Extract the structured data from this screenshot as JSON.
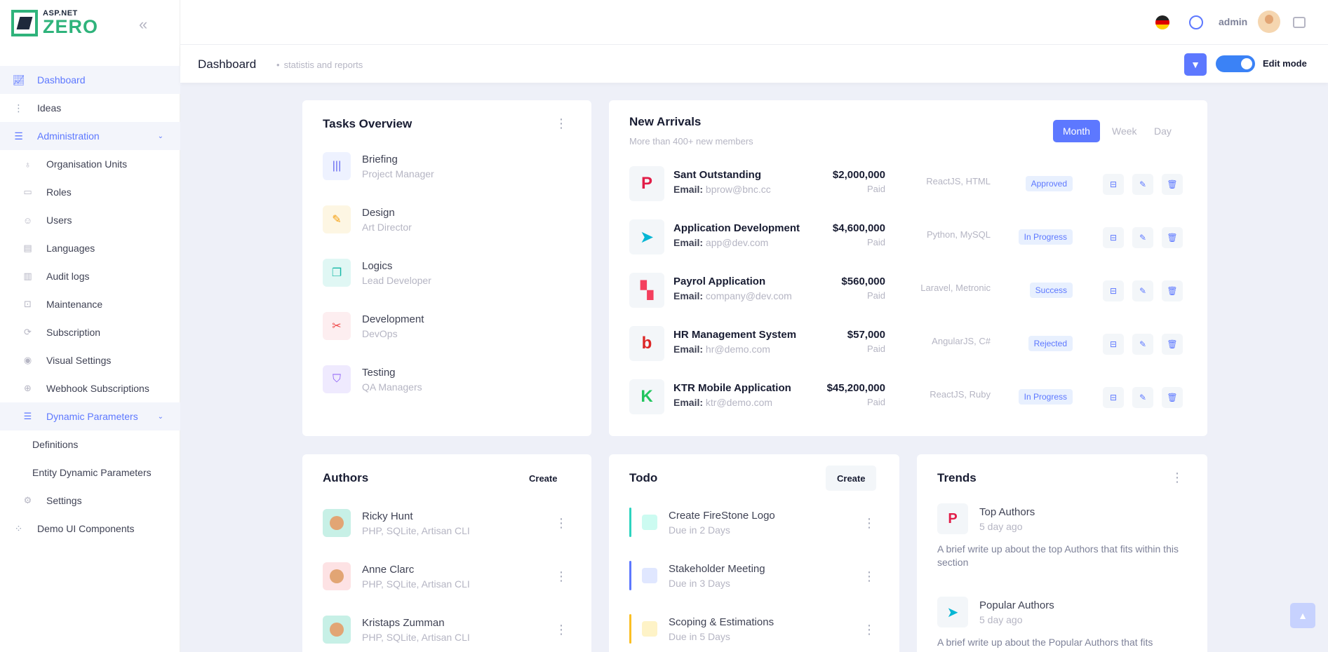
{
  "brand": {
    "line1": "ASP.NET",
    "line2": "ZERO"
  },
  "sidebar": {
    "dashboard": "Dashboard",
    "ideas": "Ideas",
    "administration": "Administration",
    "admin_items": [
      "Organisation Units",
      "Roles",
      "Users",
      "Languages",
      "Audit logs",
      "Maintenance",
      "Subscription",
      "Visual Settings",
      "Webhook Subscriptions"
    ],
    "dynamic_parameters": "Dynamic Parameters",
    "dynamic_items": [
      "Definitions",
      "Entity Dynamic Parameters"
    ],
    "settings": "Settings",
    "demo": "Demo UI Components"
  },
  "topbar": {
    "user": "admin"
  },
  "subheader": {
    "title": "Dashboard",
    "subtitle": "statistis and reports",
    "edit_mode": "Edit mode"
  },
  "tasks": {
    "title": "Tasks Overview",
    "items": [
      {
        "name": "Briefing",
        "role": "Project Manager",
        "icon": "books-icon",
        "bg": "#eef2ff",
        "color": "#6366f1"
      },
      {
        "name": "Design",
        "role": "Art Director",
        "icon": "pencil-icon",
        "bg": "#fdf6e3",
        "color": "#f59e0b"
      },
      {
        "name": "Logics",
        "role": "Lead Developer",
        "icon": "chat-icon",
        "bg": "#e0f7f4",
        "color": "#14b8a6"
      },
      {
        "name": "Development",
        "role": "DevOps",
        "icon": "magnet-icon",
        "bg": "#fdeef0",
        "color": "#ef4444"
      },
      {
        "name": "Testing",
        "role": "QA Managers",
        "icon": "shield-icon",
        "bg": "#efeafe",
        "color": "#8b5cf6"
      }
    ]
  },
  "arrivals": {
    "title": "New Arrivals",
    "subtitle": "More than 400+ new members",
    "tabs": [
      "Month",
      "Week",
      "Day"
    ],
    "email_label": "Email:",
    "rows": [
      {
        "name": "Sant Outstanding",
        "email": "bprow@bnc.cc",
        "price": "$2,000,000",
        "paid": "Paid",
        "tech": "ReactJS, HTML",
        "status": "Approved",
        "logo": "P",
        "logo_color": "#e11d48"
      },
      {
        "name": "Application Development",
        "email": "app@dev.com",
        "price": "$4,600,000",
        "paid": "Paid",
        "tech": "Python, MySQL",
        "status": "In Progress",
        "logo": "➤",
        "logo_color": "#06b6d4"
      },
      {
        "name": "Payrol Application",
        "email": "company@dev.com",
        "price": "$560,000",
        "paid": "Paid",
        "tech": "Laravel, Metronic",
        "status": "Success",
        "logo": "▚",
        "logo_color": "#f43f5e"
      },
      {
        "name": "HR Management System",
        "email": "hr@demo.com",
        "price": "$57,000",
        "paid": "Paid",
        "tech": "AngularJS, C#",
        "status": "Rejected",
        "logo": "b",
        "logo_color": "#dc2626"
      },
      {
        "name": "KTR Mobile Application",
        "email": "ktr@demo.com",
        "price": "$45,200,000",
        "paid": "Paid",
        "tech": "ReactJS, Ruby",
        "status": "In Progress",
        "logo": "K",
        "logo_color": "#22c55e"
      }
    ]
  },
  "authors": {
    "title": "Authors",
    "create": "Create",
    "items": [
      {
        "name": "Ricky Hunt",
        "skills": "PHP, SQLite, Artisan CLI",
        "bg": "#c7f0e6"
      },
      {
        "name": "Anne Clarc",
        "skills": "PHP, SQLite, Artisan CLI",
        "bg": "#fde2e4"
      },
      {
        "name": "Kristaps Zumman",
        "skills": "PHP, SQLite, Artisan CLI",
        "bg": "#c7f0e6"
      }
    ]
  },
  "todo": {
    "title": "Todo",
    "create": "Create",
    "items": [
      {
        "name": "Create FireStone Logo",
        "due": "Due in 2 Days",
        "color": "#2dd4bf",
        "box": "#ccfbf1"
      },
      {
        "name": "Stakeholder Meeting",
        "due": "Due in 3 Days",
        "color": "#5d78ff",
        "box": "#e0e7ff"
      },
      {
        "name": "Scoping & Estimations",
        "due": "Due in 5 Days",
        "color": "#fbbf24",
        "box": "#fef3c7"
      }
    ]
  },
  "trends": {
    "title": "Trends",
    "items": [
      {
        "name": "Top Authors",
        "time": "5 day ago",
        "desc": "A brief write up about the top Authors that fits within this section",
        "logo": "P",
        "color": "#e11d48"
      },
      {
        "name": "Popular Authors",
        "time": "5 day ago",
        "desc": "A brief write up about the Popular Authors that fits",
        "logo": "➤",
        "color": "#06b6d4"
      }
    ]
  }
}
